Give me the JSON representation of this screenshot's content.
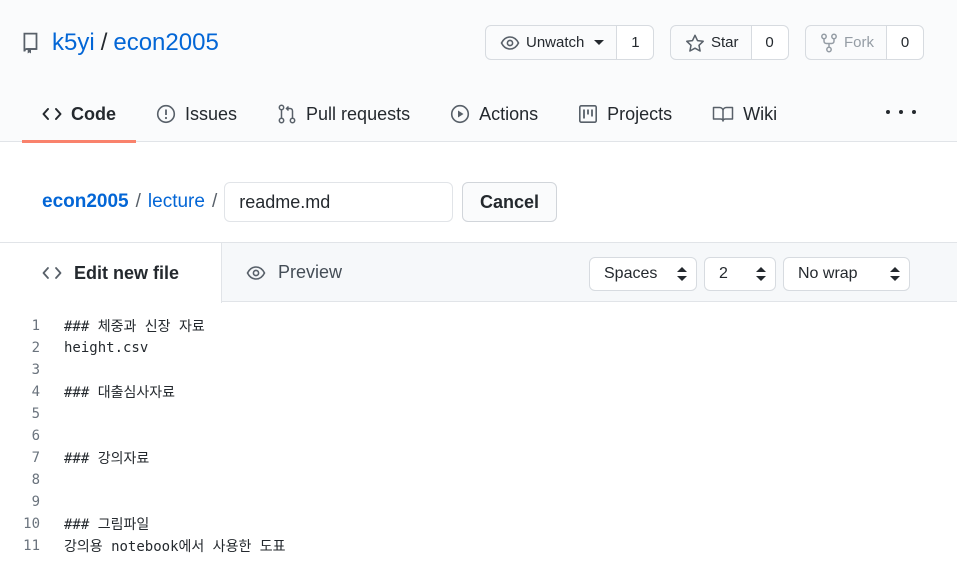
{
  "repo": {
    "owner": "k5yi",
    "separator": "/",
    "name": "econ2005"
  },
  "watch": {
    "label": "Unwatch",
    "count": "1"
  },
  "star": {
    "label": "Star",
    "count": "0"
  },
  "fork": {
    "label": "Fork",
    "count": "0"
  },
  "tabs": [
    {
      "label": "Code",
      "icon": "code-icon"
    },
    {
      "label": "Issues",
      "icon": "issue-icon"
    },
    {
      "label": "Pull requests",
      "icon": "pull-request-icon"
    },
    {
      "label": "Actions",
      "icon": "play-icon"
    },
    {
      "label": "Projects",
      "icon": "project-icon"
    },
    {
      "label": "Wiki",
      "icon": "book-icon"
    }
  ],
  "breadcrumb": {
    "root": "econ2005",
    "dir": "lecture",
    "slash": "/"
  },
  "filename": {
    "value": "readme.md"
  },
  "cancel_label": "Cancel",
  "editor": {
    "edit_tab": "Edit new file",
    "preview_tab": "Preview",
    "indent_mode": "Spaces",
    "indent_size": "2",
    "wrap_mode": "No wrap"
  },
  "lines": [
    {
      "n": "1",
      "text": "### 체중과 신장 자료"
    },
    {
      "n": "2",
      "text": "height.csv"
    },
    {
      "n": "3",
      "text": ""
    },
    {
      "n": "4",
      "text": "### 대출심사자료"
    },
    {
      "n": "5",
      "text": ""
    },
    {
      "n": "6",
      "text": ""
    },
    {
      "n": "7",
      "text": "### 강의자료"
    },
    {
      "n": "8",
      "text": ""
    },
    {
      "n": "9",
      "text": ""
    },
    {
      "n": "10",
      "text": "### 그림파일"
    },
    {
      "n": "11",
      "text": "강의용 notebook에서 사용한 도표"
    }
  ]
}
